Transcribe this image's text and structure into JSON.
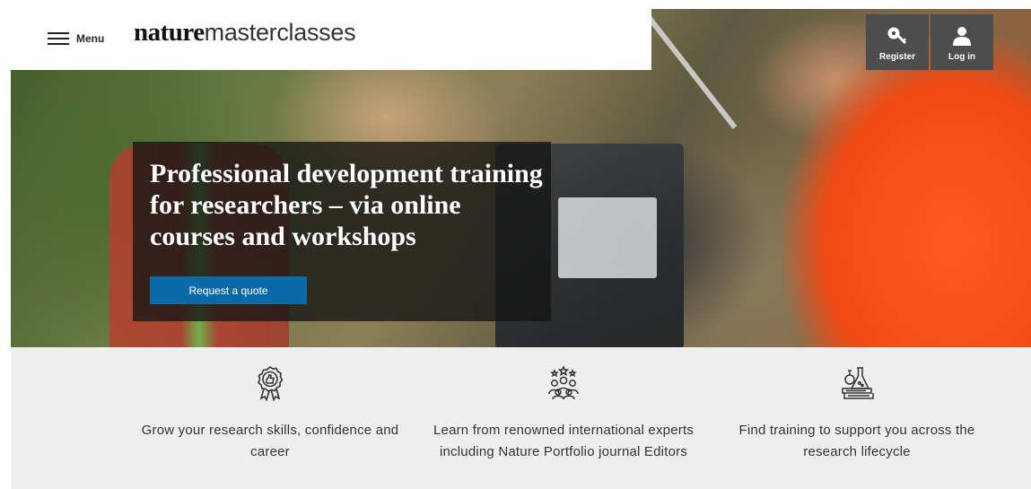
{
  "header": {
    "menu_label": "Menu",
    "logo_strong": "nature",
    "logo_light": "masterclasses"
  },
  "account": {
    "register_label": "Register",
    "login_label": "Log in"
  },
  "hero": {
    "title": "Professional development training for researchers – via online courses and workshops",
    "cta_label": "Request a quote"
  },
  "features": [
    {
      "icon": "award-ribbon-icon",
      "text": "Grow your research skills, confidence and career"
    },
    {
      "icon": "experts-group-icon",
      "text": "Learn from renowned international experts including Nature Portfolio journal Editors"
    },
    {
      "icon": "lab-flask-books-icon",
      "text": "Find training to support you across the research lifecycle"
    }
  ],
  "colors": {
    "cta_blue": "#0d6aa8",
    "account_button_bg": "#4d4d4d",
    "features_bg": "#eeeeee"
  }
}
